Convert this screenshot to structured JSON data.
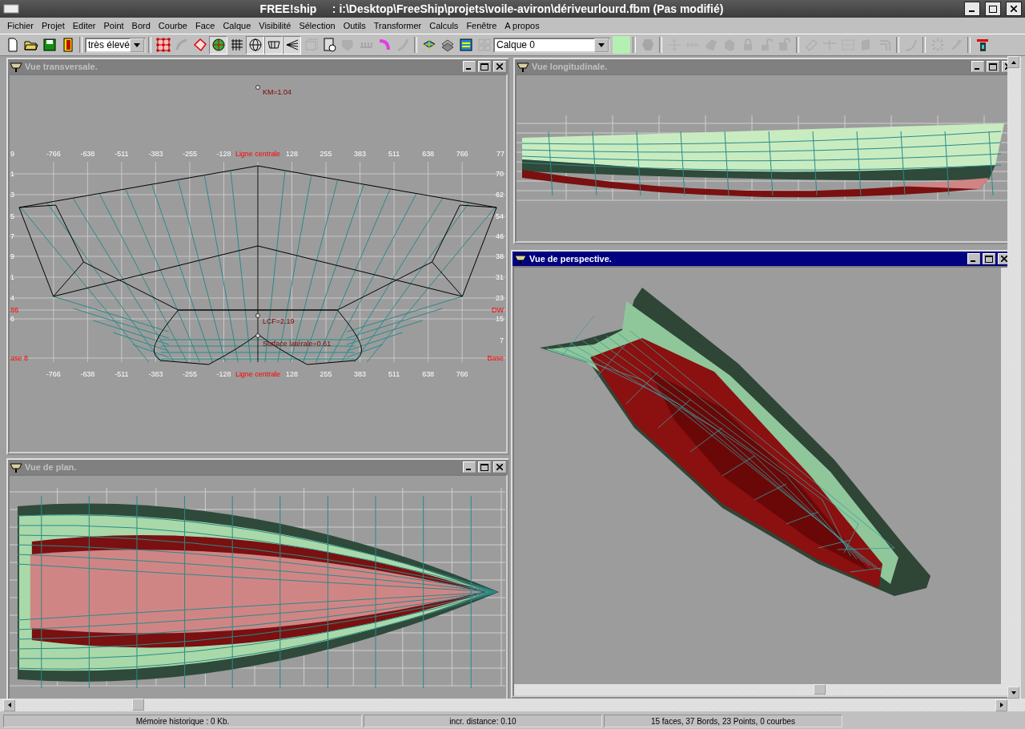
{
  "window": {
    "title": "FREE!ship     : i:\\Desktop\\FreeShip\\projets\\voile-aviron\\dériveurlourd.fbm (Pas modifié)"
  },
  "menu": [
    "Fichier",
    "Projet",
    "Editer",
    "Point",
    "Bord",
    "Courbe",
    "Face",
    "Calque",
    "Visibilité",
    "Sélection",
    "Outils",
    "Transformer",
    "Calculs",
    "Fenêtre",
    "A propos"
  ],
  "toolbar": [
    {
      "kind": "button",
      "pressed": false,
      "disabled": false
    },
    {
      "kind": "button",
      "pressed": false,
      "disabled": false
    },
    {
      "kind": "button",
      "pressed": false,
      "disabled": false
    },
    {
      "kind": "button",
      "pressed": false,
      "disabled": false
    },
    {
      "kind": "separator"
    },
    {
      "kind": "combo",
      "value": "très élevé"
    },
    {
      "kind": "separator"
    },
    {
      "kind": "button",
      "pressed": false,
      "disabled": false
    },
    {
      "kind": "button",
      "pressed": false,
      "disabled": true
    },
    {
      "kind": "button",
      "pressed": false,
      "disabled": false
    },
    {
      "kind": "button",
      "pressed": true,
      "disabled": false
    },
    {
      "kind": "button",
      "pressed": false,
      "disabled": false
    },
    {
      "kind": "button",
      "pressed": true,
      "disabled": false
    },
    {
      "kind": "button",
      "pressed": true,
      "disabled": false
    },
    {
      "kind": "button",
      "pressed": true,
      "disabled": false
    },
    {
      "kind": "button",
      "pressed": false,
      "disabled": true
    },
    {
      "kind": "button",
      "pressed": false,
      "disabled": false
    },
    {
      "kind": "button",
      "pressed": false,
      "disabled": true
    },
    {
      "kind": "button",
      "pressed": false,
      "disabled": true
    },
    {
      "kind": "button",
      "pressed": false,
      "disabled": false
    },
    {
      "kind": "button",
      "pressed": false,
      "disabled": true
    },
    {
      "kind": "separator"
    },
    {
      "kind": "button",
      "pressed": false,
      "disabled": false
    },
    {
      "kind": "button",
      "pressed": false,
      "disabled": false
    },
    {
      "kind": "button",
      "pressed": false,
      "disabled": false
    },
    {
      "kind": "button",
      "pressed": false,
      "disabled": true
    },
    {
      "kind": "combo",
      "value": "Calque 0"
    },
    {
      "kind": "swatch",
      "color": "#b4f0b4"
    },
    {
      "kind": "separator"
    },
    {
      "kind": "button",
      "pressed": false,
      "disabled": true
    },
    {
      "kind": "separator"
    },
    {
      "kind": "button",
      "pressed": false,
      "disabled": true
    },
    {
      "kind": "button",
      "pressed": false,
      "disabled": true
    },
    {
      "kind": "button",
      "pressed": false,
      "disabled": true
    },
    {
      "kind": "button",
      "pressed": false,
      "disabled": true
    },
    {
      "kind": "button",
      "pressed": false,
      "disabled": true
    },
    {
      "kind": "button",
      "pressed": false,
      "disabled": true
    },
    {
      "kind": "button",
      "pressed": false,
      "disabled": true
    },
    {
      "kind": "separator"
    },
    {
      "kind": "button",
      "pressed": false,
      "disabled": true
    },
    {
      "kind": "button",
      "pressed": false,
      "disabled": true
    },
    {
      "kind": "button",
      "pressed": false,
      "disabled": true
    },
    {
      "kind": "button",
      "pressed": false,
      "disabled": true
    },
    {
      "kind": "button",
      "pressed": false,
      "disabled": true
    },
    {
      "kind": "separator"
    },
    {
      "kind": "button",
      "pressed": false,
      "disabled": true
    },
    {
      "kind": "separator"
    },
    {
      "kind": "button",
      "pressed": false,
      "disabled": true
    },
    {
      "kind": "button",
      "pressed": false,
      "disabled": true
    },
    {
      "kind": "separator"
    },
    {
      "kind": "button",
      "pressed": false,
      "disabled": false
    }
  ],
  "views": [
    {
      "kind": "transversal",
      "title": "Vue transversale.",
      "active": false,
      "top_scale": [
        {
          "text": "9",
          "kind": "tick"
        },
        {
          "text": "-766",
          "kind": "tick"
        },
        {
          "text": "-638",
          "kind": "tick"
        },
        {
          "text": "-511",
          "kind": "tick"
        },
        {
          "text": "-383",
          "kind": "tick"
        },
        {
          "text": "-255",
          "kind": "tick"
        },
        {
          "text": "-128",
          "kind": "tick"
        },
        {
          "text": "Ligne centrale",
          "kind": "label"
        },
        {
          "text": "128",
          "kind": "tick"
        },
        {
          "text": "255",
          "kind": "tick"
        },
        {
          "text": "383",
          "kind": "tick"
        },
        {
          "text": "511",
          "kind": "tick"
        },
        {
          "text": "638",
          "kind": "tick"
        },
        {
          "text": "766",
          "kind": "tick"
        },
        {
          "text": "77",
          "kind": "tick"
        }
      ],
      "bottom_scale": [
        {
          "text": "-766",
          "kind": "tick"
        },
        {
          "text": "-638",
          "kind": "tick"
        },
        {
          "text": "-511",
          "kind": "tick"
        },
        {
          "text": "-383",
          "kind": "tick"
        },
        {
          "text": "-255",
          "kind": "tick"
        },
        {
          "text": "-128",
          "kind": "tick"
        },
        {
          "text": "Ligne centrale",
          "kind": "label"
        },
        {
          "text": "128",
          "kind": "tick"
        },
        {
          "text": "255",
          "kind": "tick"
        },
        {
          "text": "383",
          "kind": "tick"
        },
        {
          "text": "511",
          "kind": "tick"
        },
        {
          "text": "638",
          "kind": "tick"
        },
        {
          "text": "766",
          "kind": "tick"
        }
      ],
      "left_scale": [
        {
          "text": "1",
          "kind": "tick"
        },
        {
          "text": "3",
          "kind": "tick"
        },
        {
          "text": "5",
          "kind": "tick"
        },
        {
          "text": "7",
          "kind": "tick"
        },
        {
          "text": "9",
          "kind": "tick"
        },
        {
          "text": "1",
          "kind": "tick"
        },
        {
          "text": "4",
          "kind": "tick"
        },
        {
          "text": "86",
          "kind": "label"
        },
        {
          "text": "6",
          "kind": "tick"
        },
        {
          "text": "ase 8",
          "kind": "label"
        }
      ],
      "right_scale": [
        {
          "text": "70",
          "kind": "tick"
        },
        {
          "text": "62",
          "kind": "tick"
        },
        {
          "text": "54",
          "kind": "tick"
        },
        {
          "text": "46",
          "kind": "tick"
        },
        {
          "text": "38",
          "kind": "tick"
        },
        {
          "text": "31",
          "kind": "tick"
        },
        {
          "text": "23",
          "kind": "tick"
        },
        {
          "text": "DW",
          "kind": "label"
        },
        {
          "text": "15",
          "kind": "tick"
        },
        {
          "text": "7",
          "kind": "tick"
        },
        {
          "text": "Base",
          "kind": "label"
        }
      ],
      "annotations": [
        "KM=1.04",
        "LCF=2.19",
        "Surface latérale=0.61"
      ]
    },
    {
      "kind": "plan",
      "title": "Vue de plan.",
      "active": false
    },
    {
      "kind": "longitudinal",
      "title": "Vue longitudinale.",
      "active": false
    },
    {
      "kind": "perspective",
      "title": "Vue de perspective.",
      "active": true
    }
  ],
  "status_bar": [
    "Mémoire historique : 0 Kb.",
    "incr. distance: 0.10",
    "15 faces, 37 Bords, 23 Points, 0 courbes"
  ]
}
